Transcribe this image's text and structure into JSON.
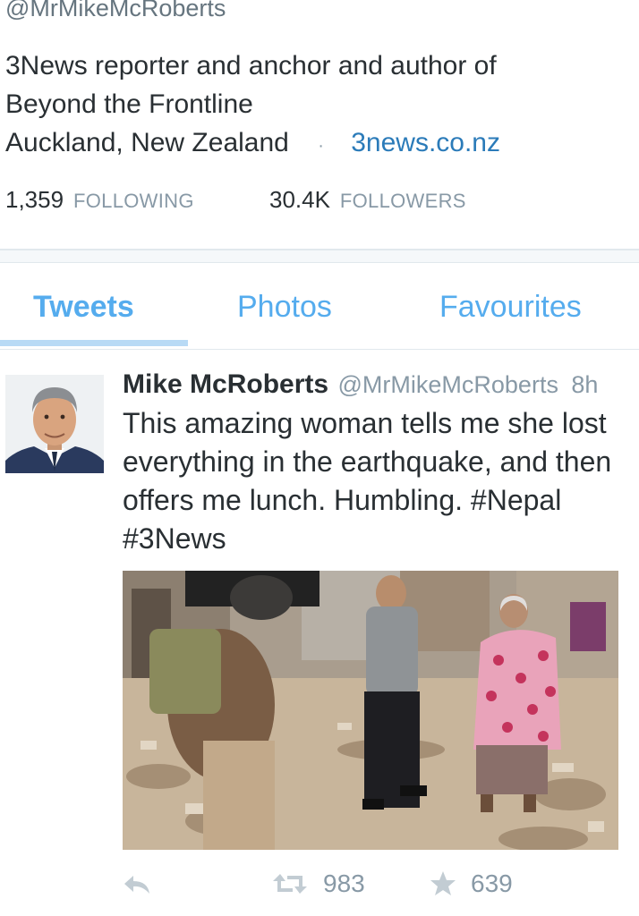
{
  "profile": {
    "handle": "@MrMikeMcRoberts",
    "bio_line1": "3News reporter and anchor and author of",
    "bio_line2": "Beyond the Frontline",
    "location": "Auckland, New Zealand",
    "separator": "·",
    "website": "3news.co.nz"
  },
  "stats": {
    "following_count": "1,359",
    "following_label": "FOLLOWING",
    "followers_count": "30.4K",
    "followers_label": "FOLLOWERS"
  },
  "tabs": [
    {
      "label": "Tweets",
      "active": true
    },
    {
      "label": "Photos",
      "active": false
    },
    {
      "label": "Favourites",
      "active": false
    }
  ],
  "tweet": {
    "author_name": "Mike McRoberts",
    "author_handle": "@MrMikeMcRoberts",
    "time": "8h",
    "text": "This amazing woman tells me she lost everything in the earthquake, and then offers me lunch. Humbling. #Nepal #3News",
    "retweet_count": "983",
    "favourite_count": "639"
  },
  "icons": {
    "reply": "reply-icon",
    "retweet": "retweet-icon",
    "favourite": "star-icon"
  },
  "colors": {
    "accent": "#55acee",
    "link": "#2b7bb9",
    "muted": "#8899a6",
    "text": "#292f33"
  }
}
